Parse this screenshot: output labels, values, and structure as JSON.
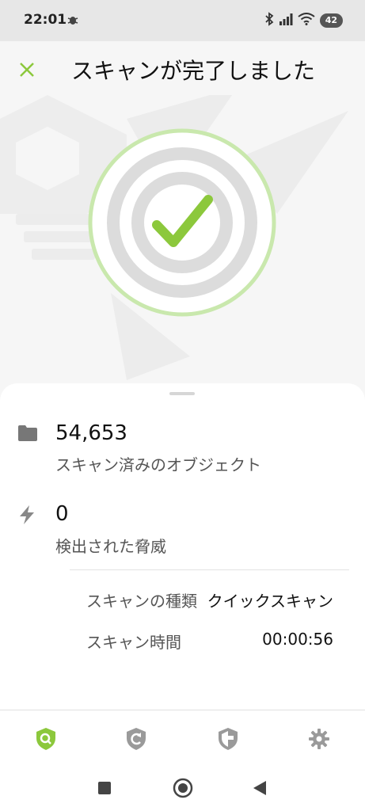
{
  "status_bar": {
    "time": "22:01",
    "battery": "42",
    "icons": [
      "bug-icon",
      "bluetooth-icon",
      "signal-icon",
      "wifi-icon",
      "battery-icon"
    ]
  },
  "header": {
    "title": "スキャンが完了しました",
    "close_icon": "close-icon"
  },
  "colors": {
    "accent": "#8cc83c",
    "ring_light": "#c9e8ad",
    "ring_gray": "#dcdcdc",
    "background": "#f6f6f6"
  },
  "stats": [
    {
      "icon": "folder-icon",
      "value": "54,653",
      "label": "スキャン済みのオブジェクト"
    },
    {
      "icon": "lightning-icon",
      "value": "0",
      "label": "検出された脅威"
    }
  ],
  "details": [
    {
      "label": "スキャンの種類",
      "value": "クイックスキャン"
    },
    {
      "label": "スキャン時間",
      "value": "00:00:56"
    }
  ],
  "bottom_nav": [
    {
      "icon": "shield-search-icon",
      "active": true
    },
    {
      "icon": "shield-update-icon",
      "active": false
    },
    {
      "icon": "shield-protection-icon",
      "active": false
    },
    {
      "icon": "gear-icon",
      "active": false
    }
  ],
  "system_nav": [
    "recents-icon",
    "home-icon",
    "back-icon"
  ]
}
